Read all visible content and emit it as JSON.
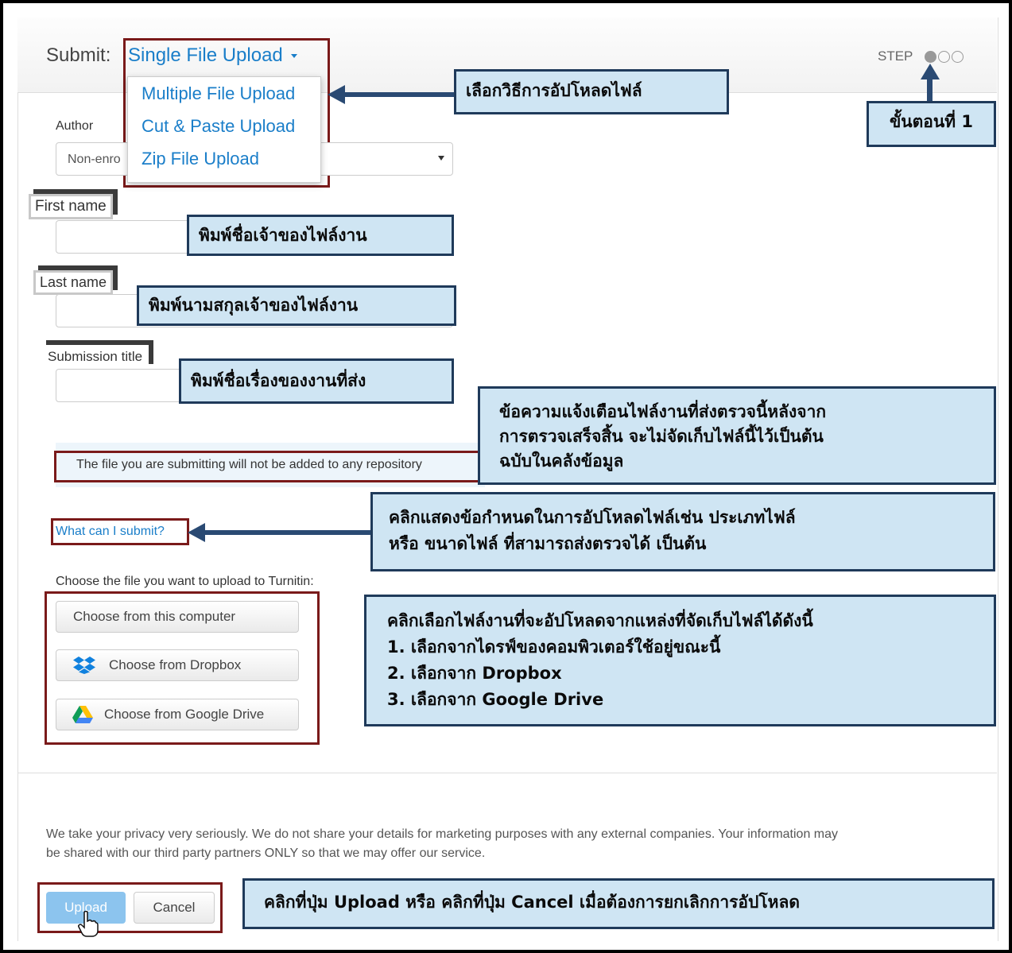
{
  "header": {
    "submit_label": "Submit:",
    "upload_method": "Single File Upload",
    "step_label": "STEP",
    "steps_total": 3,
    "current_step": 1
  },
  "upload_menu": {
    "items": [
      "Multiple File Upload",
      "Cut & Paste Upload",
      "Zip File Upload"
    ]
  },
  "form": {
    "author_label": "Author",
    "author_value": "Non-enro",
    "first_name_label": "First name",
    "last_name_label": "Last name",
    "title_label": "Submission title",
    "repository_notice": "The file you are submitting will not be added to any repository",
    "what_can_i_submit": "What can I submit?",
    "choose_file_label": "Choose the file you want to upload to Turnitin:",
    "choose_computer": "Choose from this computer",
    "choose_dropbox": "Choose from Dropbox",
    "choose_google_drive": "Choose from Google Drive"
  },
  "footer": {
    "privacy_line1": "We take your privacy very seriously. We do not share your details for marketing purposes with any external companies. Your information may",
    "privacy_line2": "be shared with our third party partners ONLY so that we may offer our service.",
    "upload_button": "Upload",
    "cancel_button": "Cancel"
  },
  "callouts": {
    "choose_method": "เลือกวิธีการอัปโหลดไฟล์",
    "step_one": "ขั้นตอนที่ 1",
    "first_name": "พิมพ์ชื่อเจ้าของไฟล์งาน",
    "last_name": "พิมพ์นามสกุลเจ้าของไฟล์งาน",
    "title": "พิมพ์ชื่อเรื่องของงานที่ส่ง",
    "notice": [
      "ข้อความแจ้งเตือนไฟล์งานที่ส่งตรวจนี้หลังจาก",
      "การตรวจเสร็จสิ้น จะไม่จัดเก็บไฟล์นี้ไว้เป็นต้น",
      "ฉบับในคลังข้อมูล"
    ],
    "what_submit": [
      "คลิกแสดงข้อกำหนดในการอัปโหลดไฟล์เช่น ประเภทไฟล์",
      "หรือ ขนาดไฟล์ ที่สามารถส่งตรวจได้ เป็นต้น"
    ],
    "choose_source": [
      "คลิกเลือกไฟล์งานที่จะอัปโหลดจากแหล่งที่จัดเก็บไฟล์ได้ดังนี้",
      "1. เลือกจากไดรฟ์ของคอมพิวเตอร์ใช้อยู่ขณะนี้",
      "2. เลือกจาก Dropbox",
      "3. เลือกจาก Google Drive"
    ],
    "upload_cancel": "คลิกที่ปุ่ม Upload หรือ คลิกที่ปุ่ม Cancel เมื่อต้องการยกเลิกการอัปโหลด"
  },
  "colors": {
    "link_blue": "#1a7ec9",
    "callout_bg": "#cfe5f3",
    "callout_border": "#1f3a5a",
    "highlight_red": "#7a1a1a",
    "upload_btn": "#8cc4ee"
  }
}
